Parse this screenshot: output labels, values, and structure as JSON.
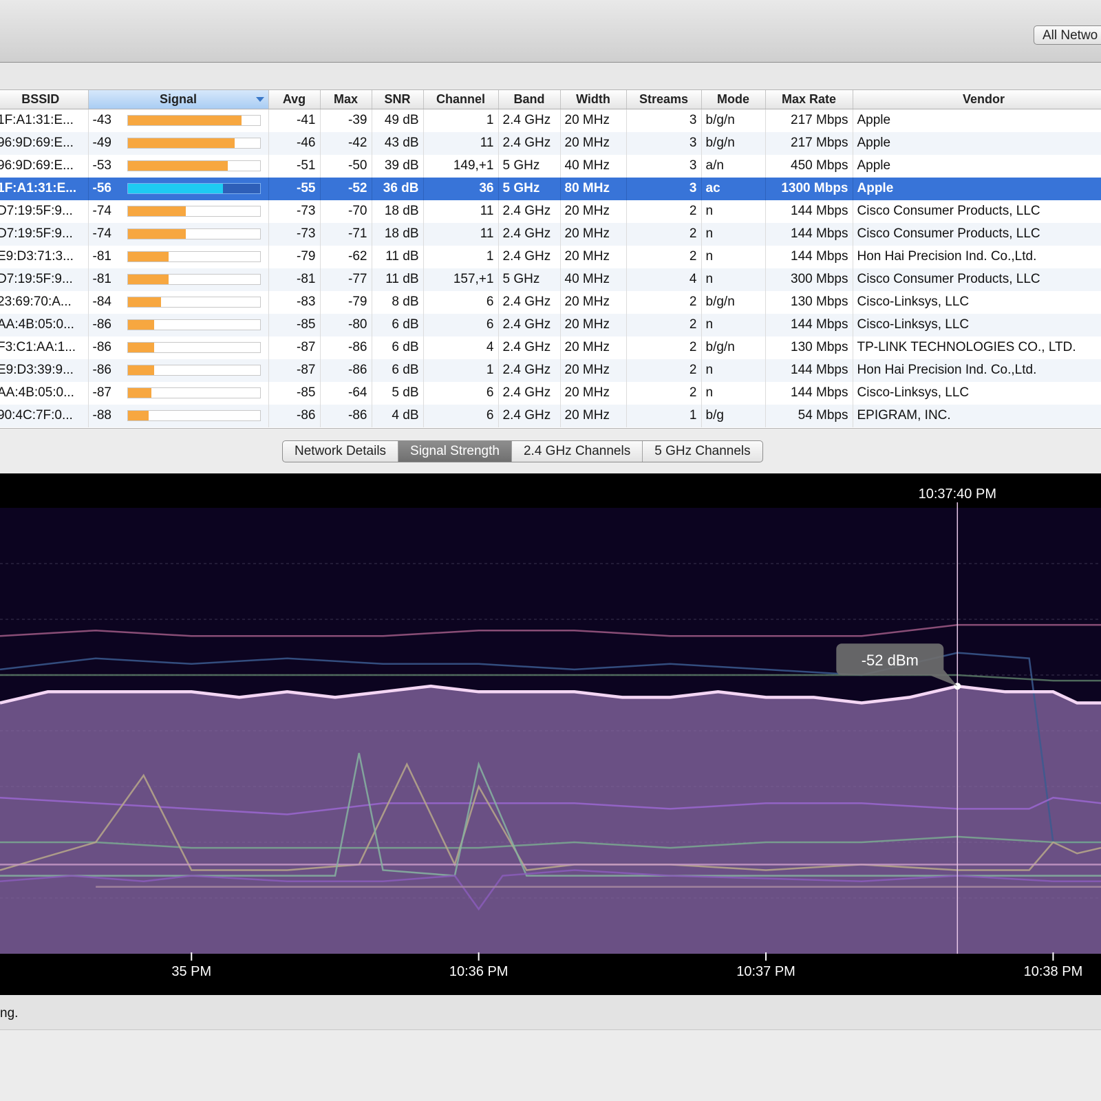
{
  "toolbar": {
    "scope_button_label": "All Netwo"
  },
  "table": {
    "columns": [
      {
        "key": "bssid",
        "label": "BSSID"
      },
      {
        "key": "signal",
        "label": "Signal"
      },
      {
        "key": "avg",
        "label": "Avg"
      },
      {
        "key": "max",
        "label": "Max"
      },
      {
        "key": "snr",
        "label": "SNR"
      },
      {
        "key": "channel",
        "label": "Channel"
      },
      {
        "key": "band",
        "label": "Band"
      },
      {
        "key": "width",
        "label": "Width"
      },
      {
        "key": "streams",
        "label": "Streams"
      },
      {
        "key": "mode",
        "label": "Mode"
      },
      {
        "key": "max_rate",
        "label": "Max Rate"
      },
      {
        "key": "vendor",
        "label": "Vendor"
      }
    ],
    "sorted_column": "signal",
    "selected_row": 3,
    "rows": [
      {
        "bssid": "1F:A1:31:E...",
        "signal": "-43",
        "avg": "-41",
        "max": "-39",
        "snr": "49 dB",
        "channel": "1",
        "band": "2.4 GHz",
        "width": "20 MHz",
        "streams": "3",
        "mode": "b/g/n",
        "max_rate": "217 Mbps",
        "vendor": "Apple",
        "level": 0.86
      },
      {
        "bssid": "96:9D:69:E...",
        "signal": "-49",
        "avg": "-46",
        "max": "-42",
        "snr": "43 dB",
        "channel": "11",
        "band": "2.4 GHz",
        "width": "20 MHz",
        "streams": "3",
        "mode": "b/g/n",
        "max_rate": "217 Mbps",
        "vendor": "Apple",
        "level": 0.81
      },
      {
        "bssid": "96:9D:69:E...",
        "signal": "-53",
        "avg": "-51",
        "max": "-50",
        "snr": "39 dB",
        "channel": "149,+1",
        "band": "5 GHz",
        "width": "40 MHz",
        "streams": "3",
        "mode": "a/n",
        "max_rate": "450 Mbps",
        "vendor": "Apple",
        "level": 0.76
      },
      {
        "bssid": "1F:A1:31:E...",
        "signal": "-56",
        "avg": "-55",
        "max": "-52",
        "snr": "36 dB",
        "channel": "36",
        "band": "5 GHz",
        "width": "80 MHz",
        "streams": "3",
        "mode": "ac",
        "max_rate": "1300 Mbps",
        "vendor": "Apple",
        "level": 0.72
      },
      {
        "bssid": "D7:19:5F:9...",
        "signal": "-74",
        "avg": "-73",
        "max": "-70",
        "snr": "18 dB",
        "channel": "11",
        "band": "2.4 GHz",
        "width": "20 MHz",
        "streams": "2",
        "mode": "n",
        "max_rate": "144 Mbps",
        "vendor": "Cisco Consumer Products, LLC",
        "level": 0.44
      },
      {
        "bssid": "D7:19:5F:9...",
        "signal": "-74",
        "avg": "-73",
        "max": "-71",
        "snr": "18 dB",
        "channel": "11",
        "band": "2.4 GHz",
        "width": "20 MHz",
        "streams": "2",
        "mode": "n",
        "max_rate": "144 Mbps",
        "vendor": "Cisco Consumer Products, LLC",
        "level": 0.44
      },
      {
        "bssid": "E9:D3:71:3...",
        "signal": "-81",
        "avg": "-79",
        "max": "-62",
        "snr": "11 dB",
        "channel": "1",
        "band": "2.4 GHz",
        "width": "20 MHz",
        "streams": "2",
        "mode": "n",
        "max_rate": "144 Mbps",
        "vendor": "Hon Hai Precision Ind. Co.,Ltd.",
        "level": 0.31
      },
      {
        "bssid": "D7:19:5F:9...",
        "signal": "-81",
        "avg": "-81",
        "max": "-77",
        "snr": "11 dB",
        "channel": "157,+1",
        "band": "5 GHz",
        "width": "40 MHz",
        "streams": "4",
        "mode": "n",
        "max_rate": "300 Mbps",
        "vendor": "Cisco Consumer Products, LLC",
        "level": 0.31
      },
      {
        "bssid": "23:69:70:A...",
        "signal": "-84",
        "avg": "-83",
        "max": "-79",
        "snr": "8 dB",
        "channel": "6",
        "band": "2.4 GHz",
        "width": "20 MHz",
        "streams": "2",
        "mode": "b/g/n",
        "max_rate": "130 Mbps",
        "vendor": "Cisco-Linksys, LLC",
        "level": 0.25
      },
      {
        "bssid": "AA:4B:05:0...",
        "signal": "-86",
        "avg": "-85",
        "max": "-80",
        "snr": "6 dB",
        "channel": "6",
        "band": "2.4 GHz",
        "width": "20 MHz",
        "streams": "2",
        "mode": "n",
        "max_rate": "144 Mbps",
        "vendor": "Cisco-Linksys, LLC",
        "level": 0.2
      },
      {
        "bssid": "F3:C1:AA:1...",
        "signal": "-86",
        "avg": "-87",
        "max": "-86",
        "snr": "6 dB",
        "channel": "4",
        "band": "2.4 GHz",
        "width": "20 MHz",
        "streams": "2",
        "mode": "b/g/n",
        "max_rate": "130 Mbps",
        "vendor": "TP-LINK TECHNOLOGIES CO., LTD.",
        "level": 0.2
      },
      {
        "bssid": "E9:D3:39:9...",
        "signal": "-86",
        "avg": "-87",
        "max": "-86",
        "snr": "6 dB",
        "channel": "1",
        "band": "2.4 GHz",
        "width": "20 MHz",
        "streams": "2",
        "mode": "n",
        "max_rate": "144 Mbps",
        "vendor": "Hon Hai Precision Ind. Co.,Ltd.",
        "level": 0.2
      },
      {
        "bssid": "AA:4B:05:0...",
        "signal": "-87",
        "avg": "-85",
        "max": "-64",
        "snr": "5 dB",
        "channel": "6",
        "band": "2.4 GHz",
        "width": "20 MHz",
        "streams": "2",
        "mode": "n",
        "max_rate": "144 Mbps",
        "vendor": "Cisco-Linksys, LLC",
        "level": 0.18
      },
      {
        "bssid": "90:4C:7F:0...",
        "signal": "-88",
        "avg": "-86",
        "max": "-86",
        "snr": "4 dB",
        "channel": "6",
        "band": "2.4 GHz",
        "width": "20 MHz",
        "streams": "1",
        "mode": "b/g",
        "max_rate": "54 Mbps",
        "vendor": "EPIGRAM, INC.",
        "level": 0.16
      }
    ]
  },
  "tabs": [
    {
      "label": "Network Details",
      "active": false
    },
    {
      "label": "Signal Strength",
      "active": true
    },
    {
      "label": "2.4 GHz Channels",
      "active": false
    },
    {
      "label": "5 GHz Channels",
      "active": false
    }
  ],
  "chart_data": {
    "type": "area",
    "x_unit": "seconds since 10:35 PM",
    "x_ticks": [
      "35 PM",
      "10:36 PM",
      "10:37 PM",
      "10:38 PM"
    ],
    "xlim": [
      -40,
      190
    ],
    "ylim": [
      -100,
      -20
    ],
    "grid": true,
    "cursor": {
      "time_label": "10:37:40 PM",
      "x": 160,
      "tooltip": "-52 dBm",
      "y": -52
    },
    "selected_series": {
      "name": "1F:A1:31:E...",
      "color": "#f4d6f4",
      "fill": "#8a6aa6",
      "x": [
        -40,
        -35,
        -30,
        0,
        10,
        20,
        30,
        40,
        50,
        60,
        70,
        80,
        90,
        100,
        110,
        120,
        130,
        140,
        150,
        160,
        170,
        180,
        185,
        190
      ],
      "y": [
        -55,
        -54,
        -53,
        -53,
        -54,
        -53,
        -54,
        -53,
        -52,
        -53,
        -53,
        -53,
        -54,
        -54,
        -53,
        -54,
        -54,
        -55,
        -54,
        -52,
        -53,
        -53,
        -55,
        -55
      ]
    },
    "series": [
      {
        "color": "#a05a86",
        "x": [
          -40,
          -20,
          0,
          20,
          40,
          60,
          80,
          100,
          120,
          140,
          160,
          180,
          190
        ],
        "y": [
          -43,
          -42,
          -43,
          -43,
          -43,
          -42,
          -42,
          -43,
          -43,
          -43,
          -41,
          -41,
          -41
        ]
      },
      {
        "color": "#3b5b8f",
        "x": [
          -40,
          -20,
          0,
          20,
          40,
          60,
          80,
          100,
          120,
          140,
          160,
          175,
          180,
          190
        ],
        "y": [
          -49,
          -47,
          -48,
          -47,
          -48,
          -48,
          -49,
          -48,
          -49,
          -50,
          -46,
          -47,
          -80,
          -80
        ]
      },
      {
        "color": "#5a7a66",
        "x": [
          -40,
          -20,
          0,
          20,
          40,
          60,
          80,
          100,
          120,
          140,
          160,
          180,
          190
        ],
        "y": [
          -50,
          -50,
          -50,
          -50,
          -50,
          -50,
          -50,
          -50,
          -50,
          -50,
          -50,
          -51,
          -51
        ]
      },
      {
        "color": "#9a66d0",
        "x": [
          -40,
          -20,
          0,
          20,
          40,
          60,
          80,
          100,
          120,
          140,
          160,
          175,
          180,
          190
        ],
        "y": [
          -72,
          -73,
          -74,
          -75,
          -73,
          -73,
          -73,
          -74,
          -73,
          -73,
          -74,
          -74,
          -72,
          -73
        ]
      },
      {
        "color": "#7aa890",
        "x": [
          -40,
          -20,
          0,
          20,
          40,
          60,
          80,
          100,
          120,
          140,
          160,
          180,
          190
        ],
        "y": [
          -80,
          -80,
          -81,
          -81,
          -81,
          -81,
          -80,
          -81,
          -80,
          -80,
          -79,
          -80,
          -80
        ]
      },
      {
        "color": "#b7a88a",
        "x": [
          -40,
          -20,
          -10,
          0,
          20,
          35,
          45,
          55,
          60,
          70,
          80,
          100,
          120,
          140,
          160,
          175,
          180,
          185,
          190
        ],
        "y": [
          -85,
          -80,
          -68,
          -85,
          -85,
          -84,
          -66,
          -84,
          -70,
          -85,
          -84,
          -84,
          -85,
          -84,
          -85,
          -85,
          -80,
          -82,
          -81
        ]
      },
      {
        "color": "#c89ac8",
        "x": [
          -40,
          -20,
          0,
          20,
          40,
          60,
          80,
          100,
          120,
          140,
          160,
          180,
          190
        ],
        "y": [
          -84,
          -84,
          -84,
          -84,
          -84,
          -84,
          -84,
          -84,
          -84,
          -84,
          -84,
          -84,
          -84
        ]
      },
      {
        "color": "#86b3a0",
        "x": [
          -40,
          -20,
          0,
          20,
          30,
          35,
          40,
          55,
          60,
          70,
          100,
          120,
          160,
          190
        ],
        "y": [
          -86,
          -86,
          -86,
          -86,
          -86,
          -64,
          -85,
          -86,
          -66,
          -86,
          -86,
          -86,
          -86,
          -86
        ]
      },
      {
        "color": "#8a5cba",
        "x": [
          -40,
          -25,
          -10,
          0,
          20,
          40,
          55,
          60,
          65,
          80,
          100,
          140,
          160,
          180,
          190
        ],
        "y": [
          -87,
          -86,
          -87,
          -86,
          -87,
          -87,
          -86,
          -92,
          -86,
          -85,
          -86,
          -87,
          -86,
          -87,
          -87
        ]
      },
      {
        "color": "#a88aa0",
        "x": [
          -20,
          0,
          20,
          40,
          60,
          80,
          100,
          120,
          140,
          160,
          180,
          190
        ],
        "y": [
          -88,
          -88,
          -88,
          -88,
          -88,
          -88,
          -88,
          -88,
          -88,
          -88,
          -88,
          -88
        ]
      }
    ]
  },
  "status": {
    "text": "ng."
  }
}
